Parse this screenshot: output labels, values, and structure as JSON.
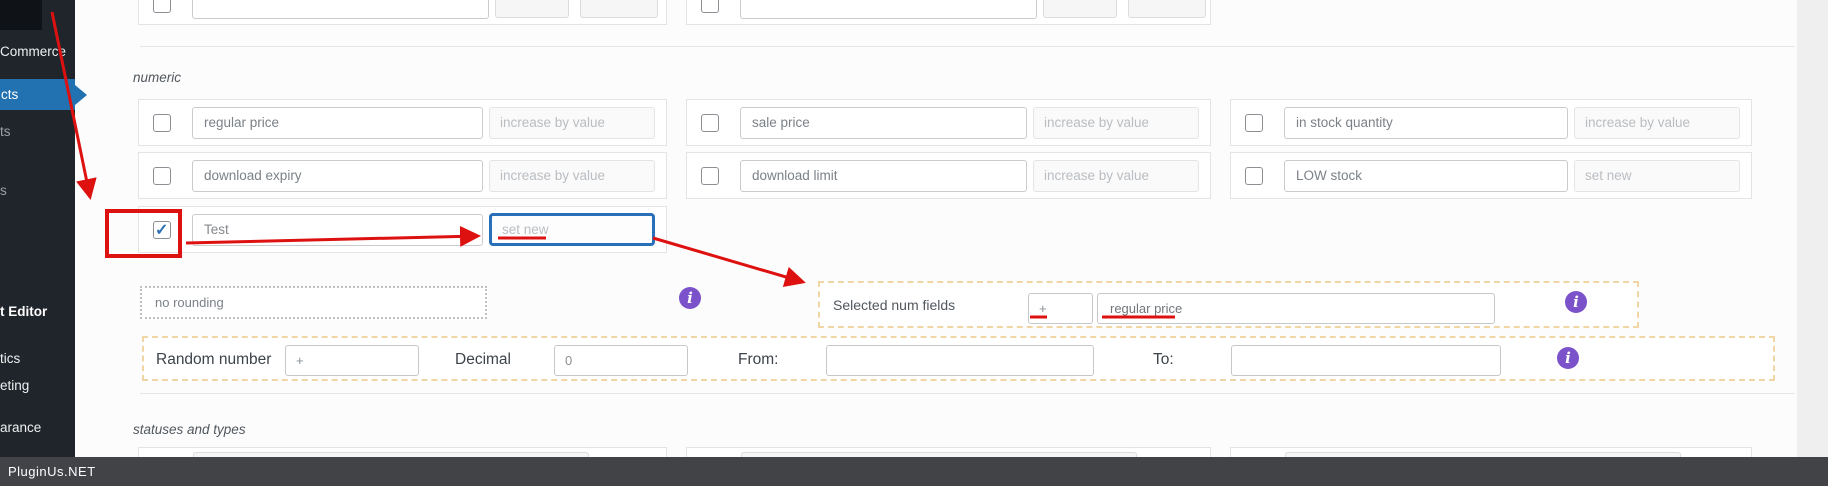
{
  "sidebar": {
    "items": [
      {
        "label": "Commerce",
        "type": "top-level"
      },
      {
        "label": "cts",
        "type": "active"
      },
      {
        "label": "ts",
        "type": "submenu"
      },
      {
        "label": "s",
        "type": "submenu"
      },
      {
        "label": "t Editor",
        "type": "submenu-active"
      },
      {
        "label": "tics",
        "type": "top-level"
      },
      {
        "label": "eting",
        "type": "top-level"
      },
      {
        "label": "arance",
        "type": "top-level"
      }
    ]
  },
  "watermark": {
    "text": "PluginUs.NET"
  },
  "numeric_section": {
    "label": "numeric",
    "rows": [
      {
        "cells": [
          {
            "field": "regular price",
            "action": "increase by value",
            "checked": false
          },
          {
            "field": "sale price",
            "action": "increase by value",
            "checked": false
          },
          {
            "field": "in stock quantity",
            "action": "increase by value",
            "checked": false
          }
        ]
      },
      {
        "cells": [
          {
            "field": "download expiry",
            "action": "increase by value",
            "checked": false
          },
          {
            "field": "download limit",
            "action": "increase by value",
            "checked": false
          },
          {
            "field": "LOW stock",
            "action": "set new",
            "checked": false
          }
        ]
      }
    ],
    "selected_row": {
      "checked": true,
      "value": "Test",
      "action": "set new"
    },
    "rounding": {
      "value": "no rounding"
    },
    "selected_num_fields": {
      "label": "Selected num fields",
      "operator": "+",
      "field": "regular price"
    },
    "random": {
      "label": "Random number",
      "operator": "+",
      "decimal_label": "Decimal",
      "decimal_value": "0",
      "from_label": "From:",
      "from_value": "",
      "to_label": "To:",
      "to_value": ""
    }
  },
  "statuses_section": {
    "label": "statuses and types"
  },
  "icons": {
    "info_glyph": "i",
    "check_glyph": "✓"
  },
  "colors": {
    "accent_blue": "#2271b1",
    "annotation_red": "#de1111",
    "info_purple": "#7b52c9",
    "dashed_orange": "#f0d6a4",
    "sidebar_bg": "#20252b",
    "bottom_bar_bg": "#414347"
  }
}
